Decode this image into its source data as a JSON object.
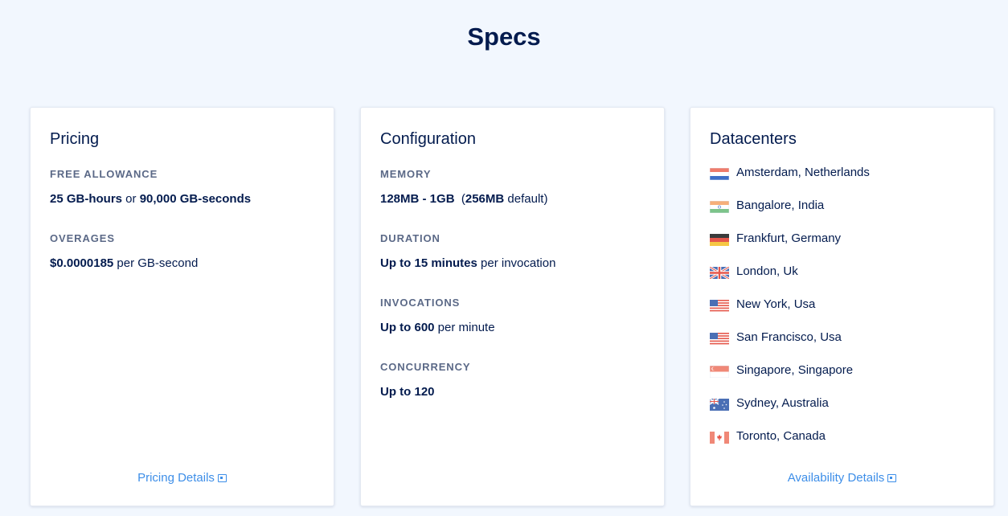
{
  "page": {
    "title": "Specs"
  },
  "pricing": {
    "title": "Pricing",
    "free_allowance_label": "FREE ALLOWANCE",
    "free_allowance_part1": "25 GB-hours",
    "free_allowance_or": " or ",
    "free_allowance_part2": "90,000 GB-seconds",
    "overages_label": "OVERAGES",
    "overages_value": "$0.0000185",
    "overages_suffix": " per GB-second",
    "details_link": "Pricing Details"
  },
  "configuration": {
    "title": "Configuration",
    "memory_label": "MEMORY",
    "memory_value": "128MB - 1GB",
    "memory_paren_open": "  (",
    "memory_default": "256MB",
    "memory_suffix": " default)",
    "duration_label": "DURATION",
    "duration_value": "Up to 15 minutes",
    "duration_suffix": " per invocation",
    "invocations_label": "INVOCATIONS",
    "invocations_value": "Up to 600",
    "invocations_suffix": " per minute",
    "concurrency_label": "CONCURRENCY",
    "concurrency_value": "Up to 120"
  },
  "datacenters": {
    "title": "Datacenters",
    "items": [
      {
        "label": "Amsterdam, Netherlands",
        "flag": "netherlands-flag-icon"
      },
      {
        "label": "Bangalore, India",
        "flag": "india-flag-icon"
      },
      {
        "label": "Frankfurt, Germany",
        "flag": "germany-flag-icon"
      },
      {
        "label": "London, Uk",
        "flag": "uk-flag-icon"
      },
      {
        "label": "New York, Usa",
        "flag": "usa-flag-icon"
      },
      {
        "label": "San Francisco, Usa",
        "flag": "usa-flag-icon"
      },
      {
        "label": "Singapore, Singapore",
        "flag": "singapore-flag-icon"
      },
      {
        "label": "Sydney, Australia",
        "flag": "australia-flag-icon"
      },
      {
        "label": "Toronto, Canada",
        "flag": "canada-flag-icon"
      }
    ],
    "details_link": "Availability Details"
  },
  "colors": {
    "background": "#f2f7fe",
    "text_primary": "#031b4e",
    "label_gray": "#5b6987",
    "link_blue": "#3d8ee8"
  }
}
